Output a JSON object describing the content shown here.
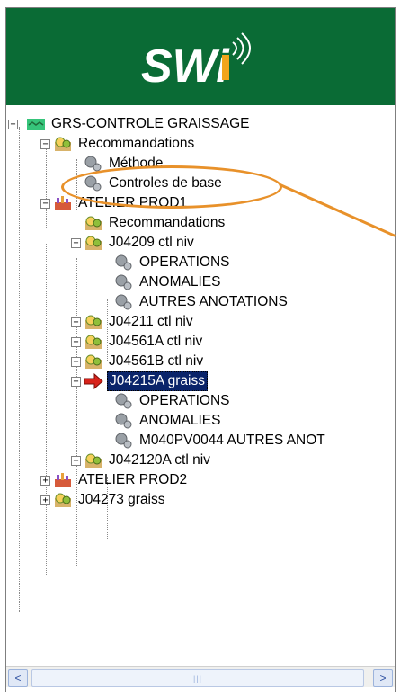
{
  "header": {
    "logo_text": "SWi",
    "brand_color": "#0a6b35"
  },
  "tree": {
    "nodes": [
      {
        "label": "GRS-CONTROLE GRAISSAGE",
        "icon": "root-flag-icon"
      },
      {
        "label": "Recommandations",
        "icon": "gear-folder-icon"
      },
      {
        "label": "Méthode",
        "icon": "gear-icon"
      },
      {
        "label": "Controles de base",
        "icon": "gear-icon"
      },
      {
        "label": "ATELIER PROD1",
        "icon": "workshop-icon"
      },
      {
        "label": "Recommandations",
        "icon": "gear-folder-icon"
      },
      {
        "label": "J04209 ctl niv",
        "icon": "gear-folder-icon"
      },
      {
        "label": "OPERATIONS",
        "icon": "gear-icon"
      },
      {
        "label": "ANOMALIES",
        "icon": "gear-icon"
      },
      {
        "label": "AUTRES ANOTATIONS",
        "icon": "gear-icon"
      },
      {
        "label": "J04211 ctl niv",
        "icon": "gear-folder-icon"
      },
      {
        "label": "J04561A ctl niv",
        "icon": "gear-folder-icon"
      },
      {
        "label": "J04561B ctl niv",
        "icon": "gear-folder-icon"
      },
      {
        "label": "J04215A graiss",
        "icon": "red-arrow-icon",
        "selected": true
      },
      {
        "label": "OPERATIONS",
        "icon": "gear-icon"
      },
      {
        "label": "ANOMALIES",
        "icon": "gear-icon"
      },
      {
        "label": "M040PV0044 AUTRES ANOT",
        "icon": "gear-icon"
      },
      {
        "label": "J042120A ctl niv",
        "icon": "gear-folder-icon"
      },
      {
        "label": "ATELIER PROD2",
        "icon": "workshop-icon"
      },
      {
        "label": "J04273 graiss",
        "icon": "gear-folder-icon"
      }
    ]
  },
  "annotation": {
    "highlight_color": "#e8912a"
  },
  "scrollbar": {
    "left_arrow": "<",
    "right_arrow": ">"
  }
}
